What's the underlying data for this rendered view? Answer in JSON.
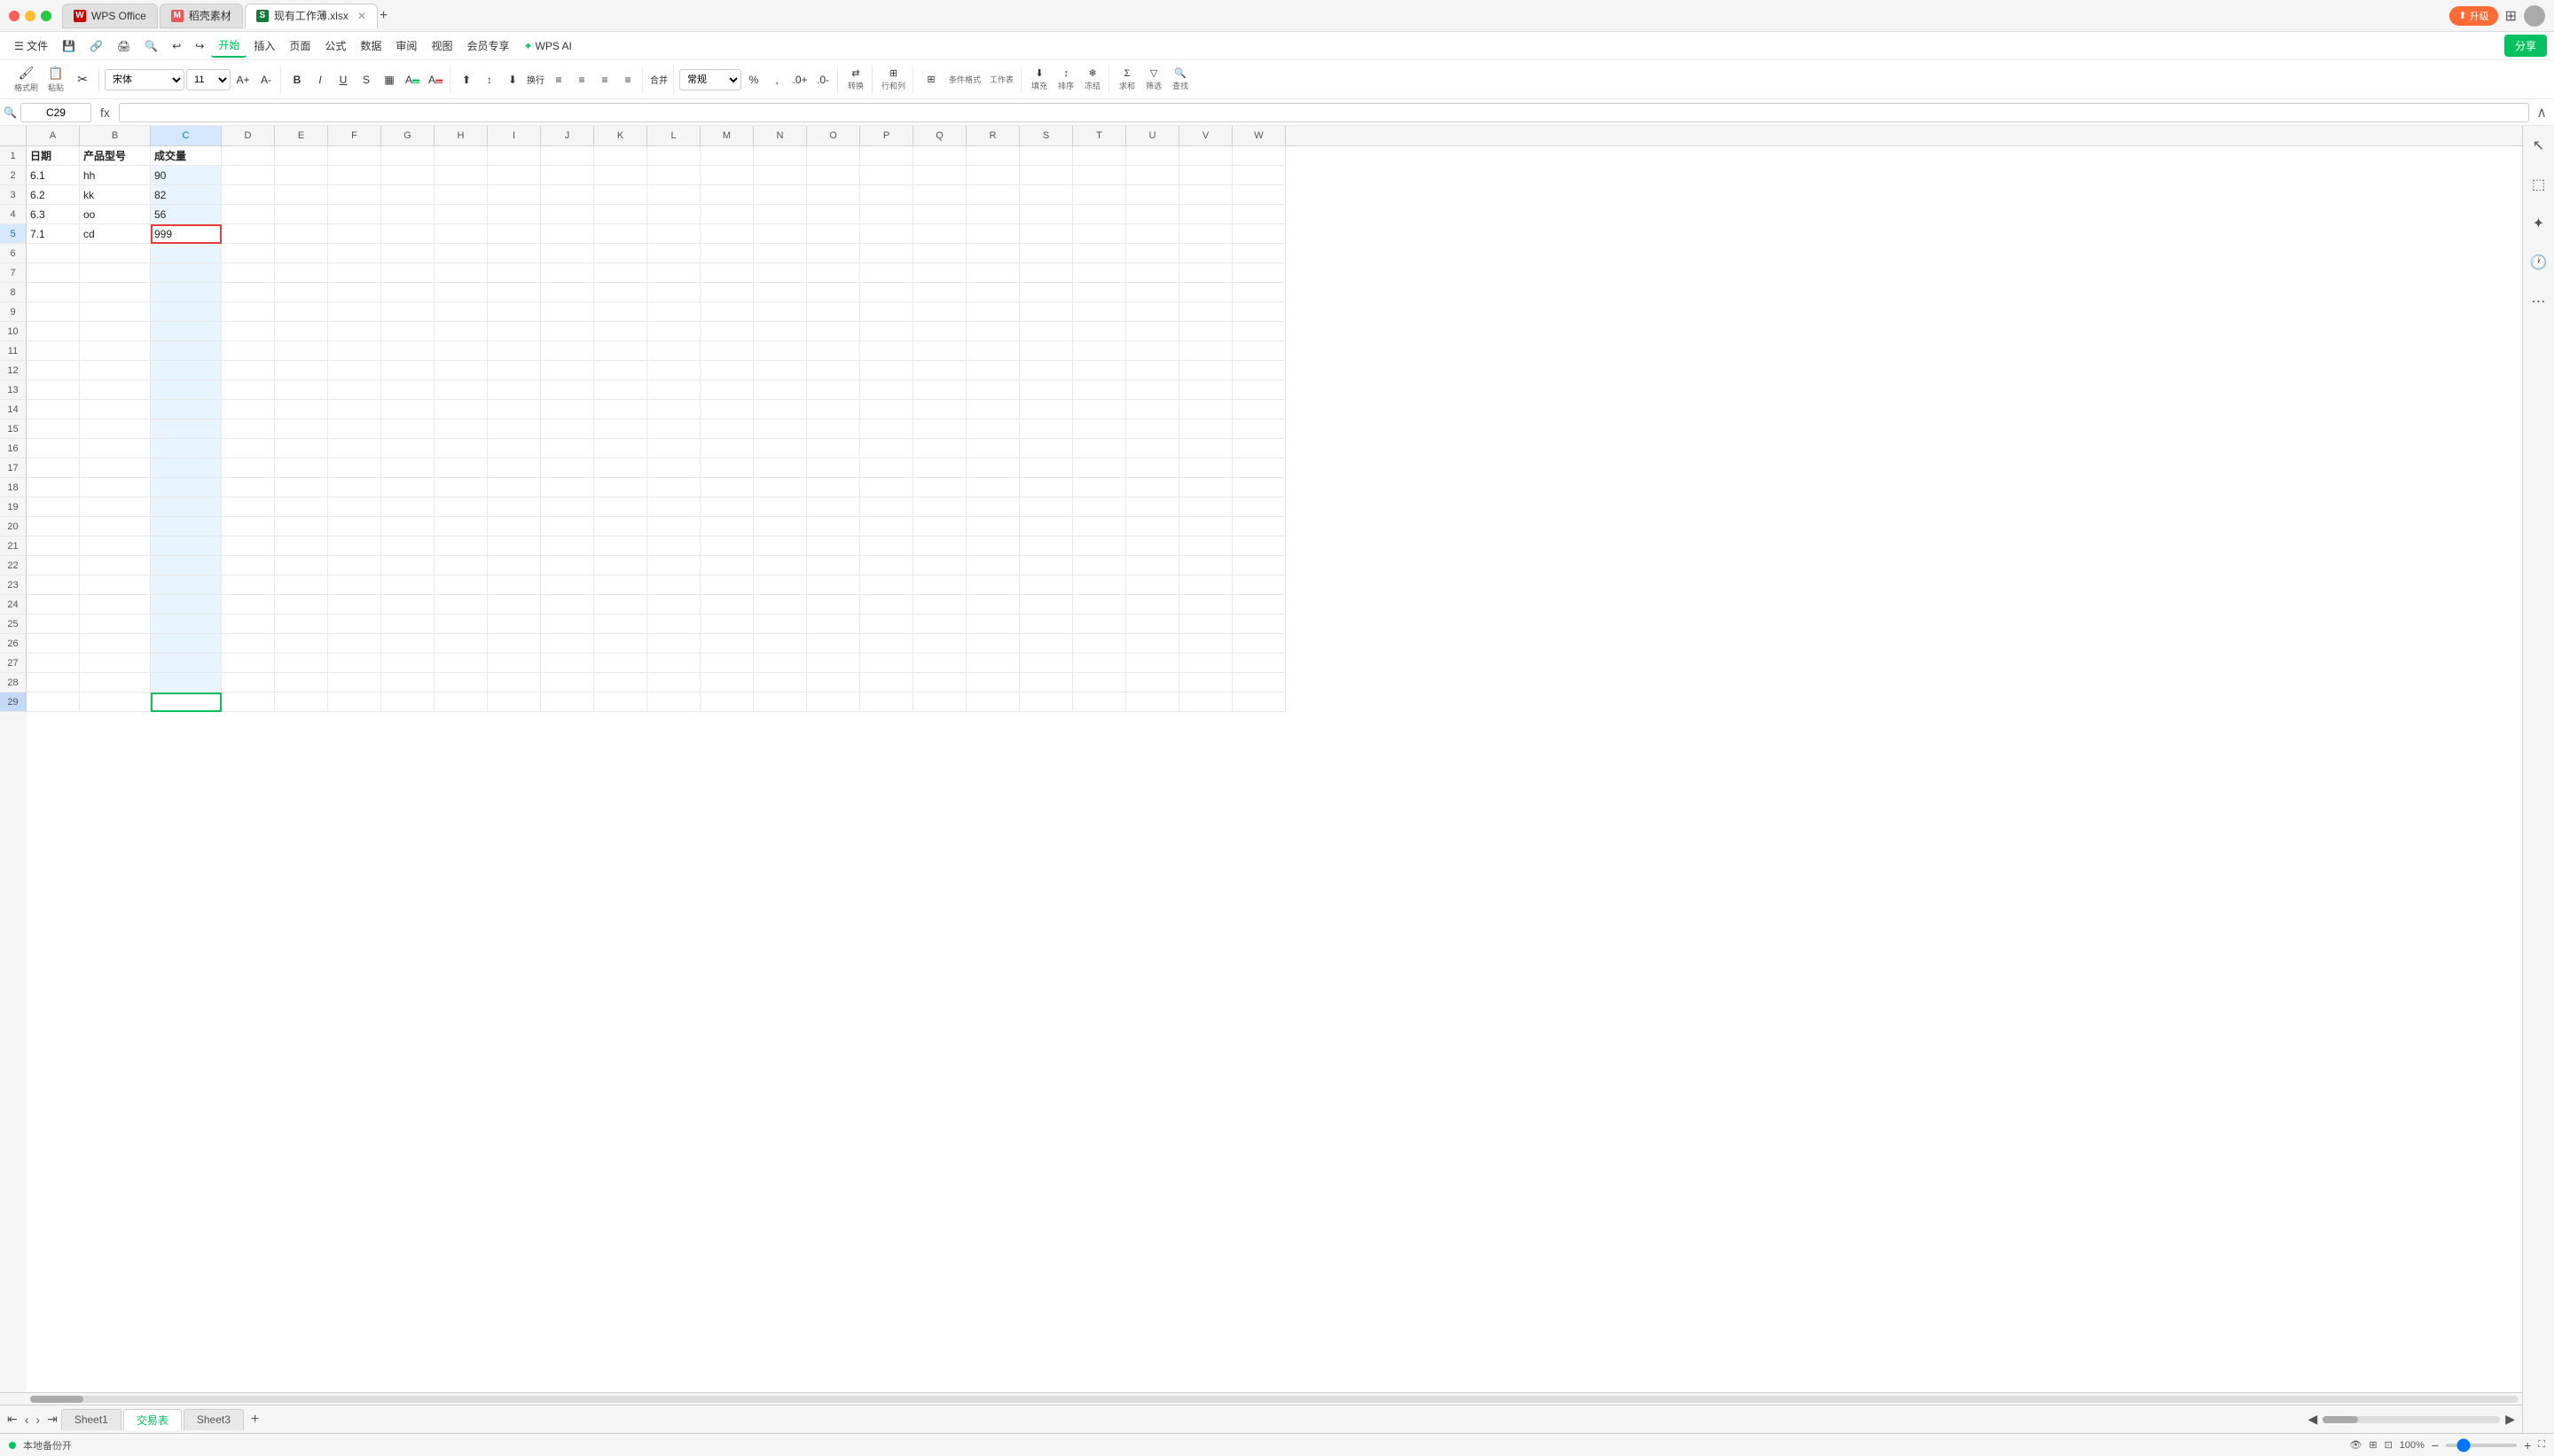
{
  "titlebar": {
    "tabs": [
      {
        "id": "wps",
        "label": "WPS Office",
        "icon": "W",
        "icon_color": "#c00",
        "active": false
      },
      {
        "id": "daoke",
        "label": "稻壳素材",
        "icon": "M",
        "icon_color": "#e55",
        "active": false
      },
      {
        "id": "sheet",
        "label": "现有工作薄.xlsx",
        "icon": "S",
        "icon_color": "#1a7a3c",
        "active": true
      }
    ],
    "upgrade_label": "升级",
    "add_tab": "+"
  },
  "menubar": {
    "items": [
      {
        "id": "file",
        "label": "文件"
      },
      {
        "id": "save",
        "label": "💾"
      },
      {
        "id": "history",
        "label": "🔗"
      },
      {
        "id": "print",
        "label": "🖨"
      },
      {
        "id": "find",
        "label": "🔍"
      },
      {
        "id": "undo",
        "label": "↩"
      },
      {
        "id": "redo",
        "label": "↪"
      },
      {
        "id": "start",
        "label": "开始",
        "active": true
      },
      {
        "id": "insert",
        "label": "插入"
      },
      {
        "id": "page",
        "label": "页面"
      },
      {
        "id": "formula",
        "label": "公式"
      },
      {
        "id": "data",
        "label": "数据"
      },
      {
        "id": "review",
        "label": "审阅"
      },
      {
        "id": "view",
        "label": "视图"
      },
      {
        "id": "member",
        "label": "会员专享"
      },
      {
        "id": "wpsai",
        "label": "WPS AI"
      }
    ],
    "share_label": "分享"
  },
  "toolbar": {
    "format_brush": "格式刷",
    "paste": "粘贴",
    "cut": "✂",
    "font_family": "宋体",
    "font_size": "11",
    "bold": "B",
    "italic": "I",
    "underline": "U",
    "strikethrough": "S̶",
    "align_left": "≡",
    "align_center": "≡",
    "align_right": "≡",
    "wrap": "换行",
    "merge": "合并",
    "number_format": "常规",
    "convert": "转换",
    "row_col": "行和列",
    "fill": "填充",
    "sort": "排序",
    "freeze": "冻结",
    "cond_format": "条件格式",
    "work_table": "工作表",
    "sum": "求和",
    "filter": "筛选",
    "find": "查找"
  },
  "formula_bar": {
    "cell_ref": "C29",
    "formula_label": "fx"
  },
  "columns": [
    "A",
    "B",
    "C",
    "D",
    "E",
    "F",
    "G",
    "H",
    "I",
    "J",
    "K",
    "L",
    "M",
    "N",
    "O",
    "P",
    "Q",
    "R",
    "S",
    "T",
    "U",
    "V",
    "W"
  ],
  "rows": [
    1,
    2,
    3,
    4,
    5,
    6,
    7,
    8,
    9,
    10,
    11,
    12,
    13,
    14,
    15,
    16,
    17,
    18,
    19,
    20,
    21,
    22,
    23,
    24,
    25,
    26,
    27,
    28,
    29
  ],
  "data": {
    "headers": {
      "A": "日期",
      "B": "产品型号",
      "C": "成交量"
    },
    "rows": [
      {
        "row": 2,
        "A": "6.1",
        "B": "hh",
        "C": "90"
      },
      {
        "row": 3,
        "A": "6.2",
        "B": "kk",
        "C": "82"
      },
      {
        "row": 4,
        "A": "6.3",
        "B": "oo",
        "C": "56"
      },
      {
        "row": 5,
        "A": "7.1",
        "B": "cd",
        "C": "999"
      }
    ]
  },
  "active_cell": "C29",
  "highlighted_row": 5,
  "sheet_tabs": [
    {
      "id": "sheet1",
      "label": "Sheet1",
      "active": false
    },
    {
      "id": "jiaoyibiao",
      "label": "交易表",
      "active": true
    },
    {
      "id": "sheet3",
      "label": "Sheet3",
      "active": false
    }
  ],
  "statusbar": {
    "backup_label": "本地备份开",
    "zoom": "100%",
    "view_icons": [
      "normal",
      "layout",
      "custom"
    ]
  }
}
